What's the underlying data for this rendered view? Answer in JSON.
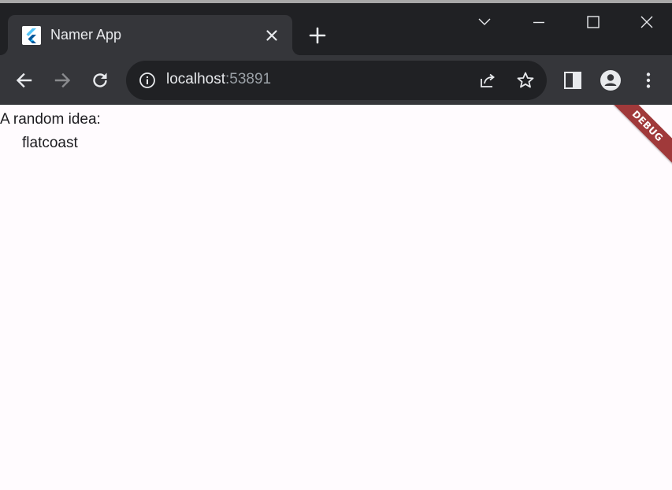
{
  "browser": {
    "tab": {
      "title": "Namer App",
      "favicon": "flutter-logo-icon",
      "close_icon": "close-icon"
    },
    "new_tab_icon": "plus-icon",
    "window_controls": [
      "tab-search-chevron-icon",
      "minimize-icon",
      "maximize-icon",
      "close-icon"
    ],
    "toolbar": {
      "back_icon": "arrow-left-icon",
      "forward_icon": "arrow-right-icon",
      "reload_icon": "reload-icon",
      "address": {
        "host": "localhost",
        "port": ":53891"
      },
      "share_icon": "share-icon",
      "bookmark_icon": "star-icon",
      "side_panel_icon": "side-panel-icon",
      "profile_icon": "avatar-icon",
      "menu_icon": "kebab-menu-icon"
    },
    "colors": {
      "titlebar": "#202124",
      "tab_active": "#35363a",
      "toolbar": "#35363a",
      "omnibox": "#202124",
      "page_background": "#fffbfe",
      "debug_banner": "#a0393a"
    }
  },
  "page": {
    "label": "A random idea:",
    "idea": "flatcoast",
    "debug_banner": "DEBUG"
  }
}
